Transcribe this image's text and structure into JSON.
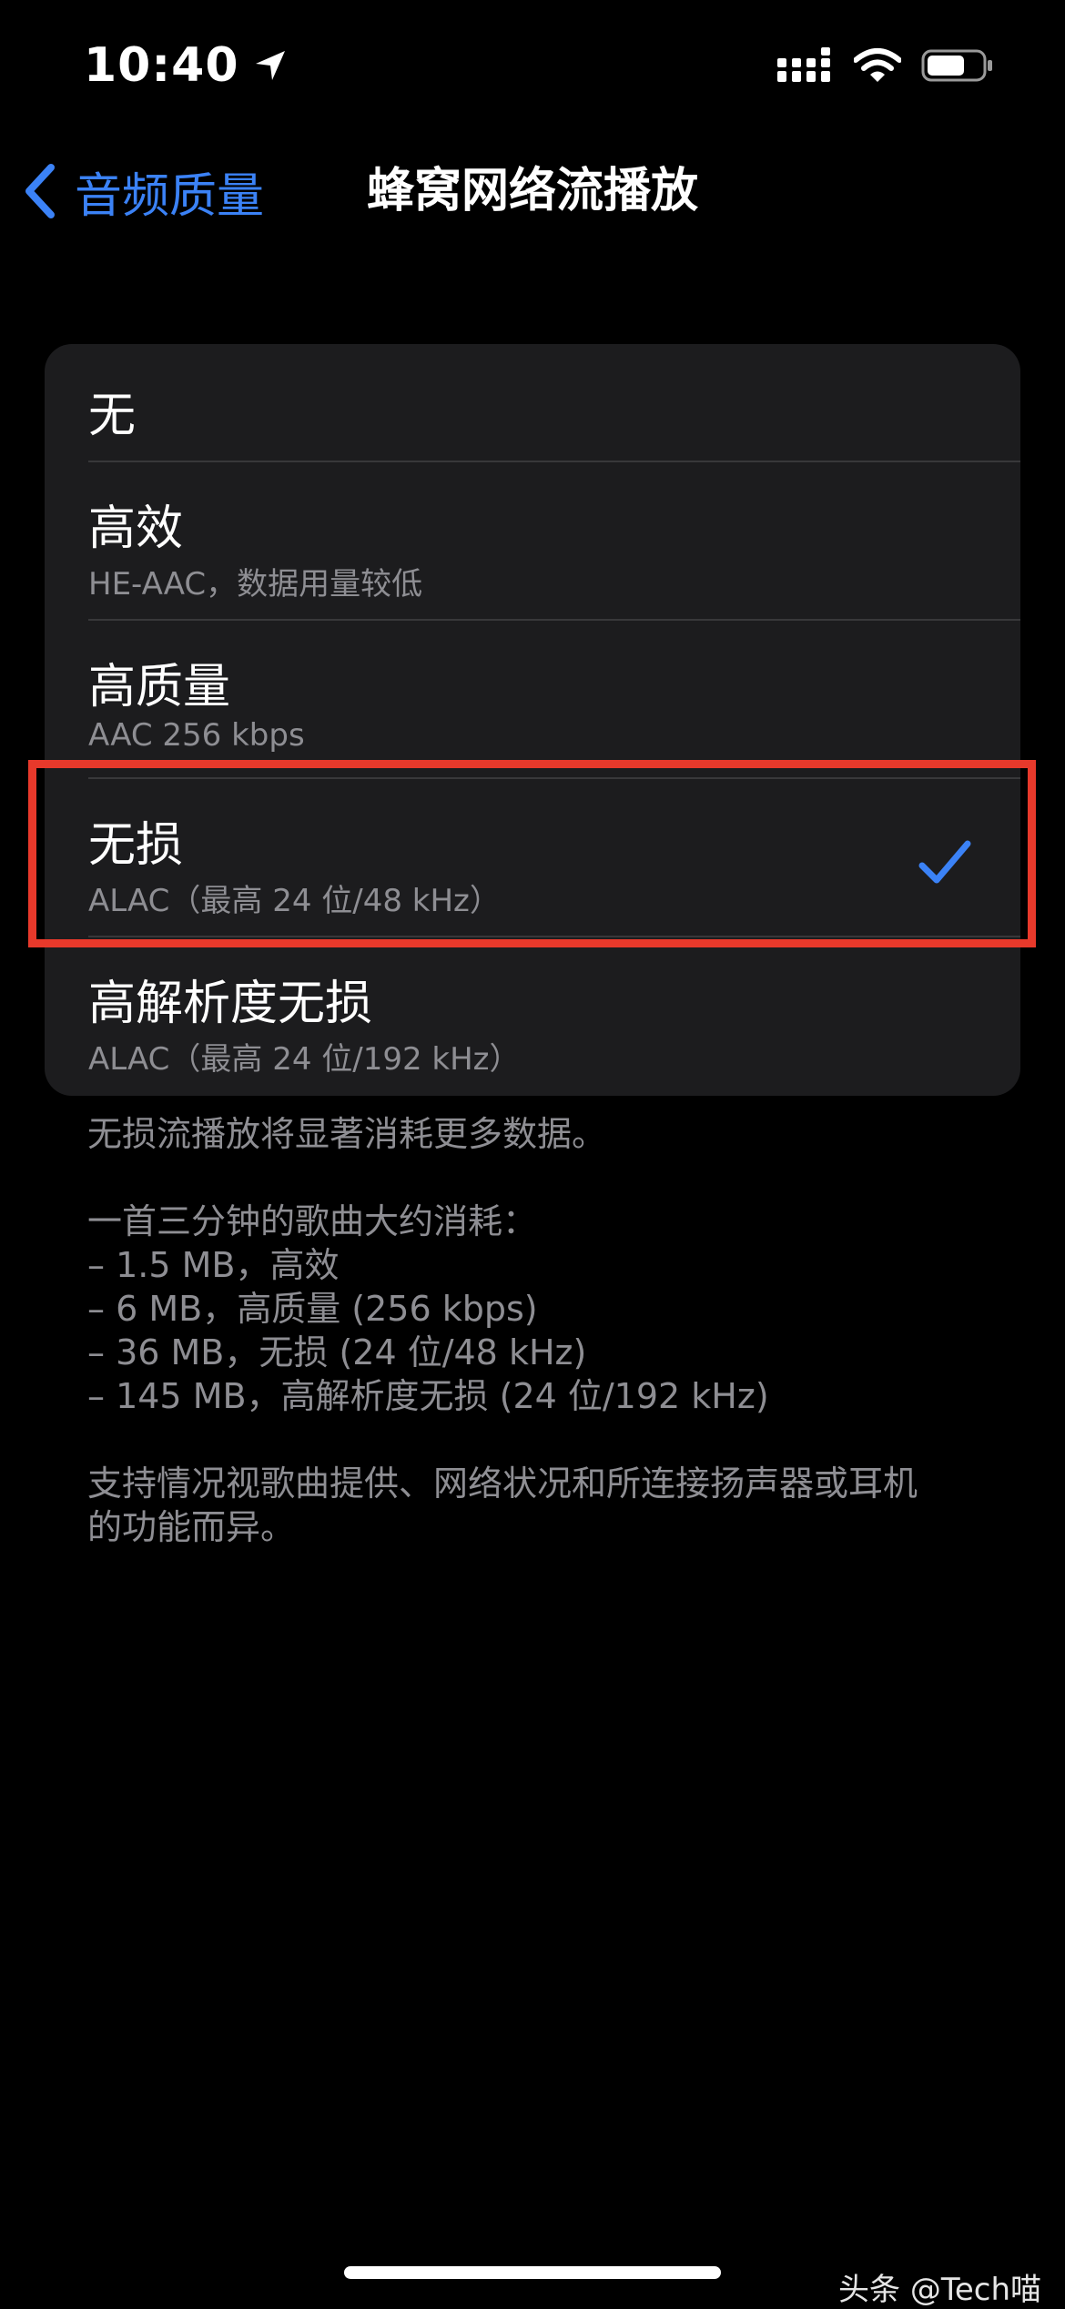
{
  "status_bar": {
    "time": "10:40"
  },
  "nav": {
    "back_label": "音频质量",
    "title": "蜂窝网络流播放"
  },
  "options": [
    {
      "title": "无",
      "subtitle": "",
      "selected": false
    },
    {
      "title": "高效",
      "subtitle": "HE-AAC，数据用量较低",
      "selected": false
    },
    {
      "title": "高质量",
      "subtitle": "AAC 256 kbps",
      "selected": false
    },
    {
      "title": "无损",
      "subtitle": "ALAC（最高 24 位/48 kHz）",
      "selected": true
    },
    {
      "title": "高解析度无损",
      "subtitle": "ALAC（最高 24 位/192 kHz）",
      "selected": false
    }
  ],
  "footer": {
    "note": "无损流播放将显著消耗更多数据。",
    "usage_heading": "一首三分钟的歌曲大约消耗：",
    "usage_items": [
      "– 1.5 MB，高效",
      "– 6 MB，高质量 (256 kbps)",
      "– 36 MB，无损 (24 位/48 kHz)",
      "– 145 MB，高解析度无损 (24 位/192 kHz)"
    ],
    "support_line1": "支持情况视歌曲提供、网络状况和所连接扬声器或耳机",
    "support_line2": "的功能而异。"
  },
  "watermark": "头条 @Tech喵",
  "colors": {
    "background": "#000000",
    "card": "#1c1c1e",
    "accent": "#3b82f6",
    "secondary_text": "#8e8e93",
    "highlight": "#e8392b"
  },
  "icons": {
    "location": "location-arrow-icon",
    "signal": "cellular-signal-icon",
    "wifi": "wifi-icon",
    "battery": "battery-icon",
    "back": "chevron-left-icon",
    "check": "checkmark-icon"
  }
}
